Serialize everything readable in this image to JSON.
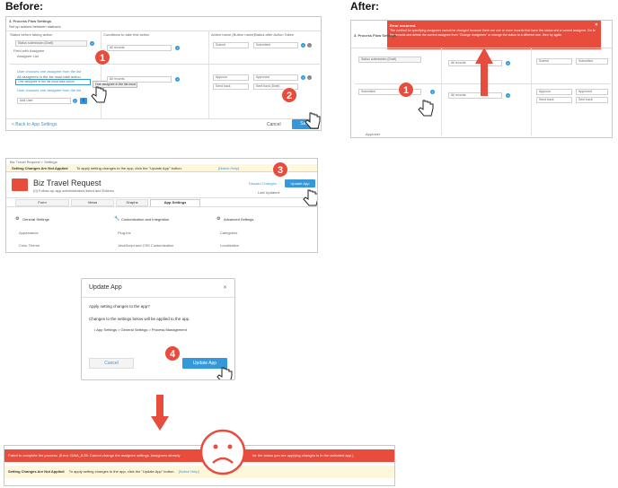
{
  "headings": {
    "before": "Before:",
    "after": "After:"
  },
  "before_panel": {
    "title": "3. Process Flow Settings",
    "subtitle": "Set up actions between statuses",
    "col_status_before": "Status before taking action",
    "col_conditions": "Conditions to take this action",
    "col_action_name": "Action name (Button name)",
    "col_status_after": "Status after Action Taken",
    "status1": "Status submission (Draft)",
    "assignee_label": "Field with Assignee",
    "assignee_list": "Assignee List",
    "condition": "All records",
    "action1": "Submit",
    "after1": "Submitted",
    "user_choose": "User chooses one assignee from the list",
    "opt1": "All assignees in the list must take action",
    "opt2": "One assignee in the list must take action",
    "dropdown_hint": "One assignee in the list must take action",
    "action2": "Approve",
    "after2": "Approved",
    "action3": "Send back",
    "after3": "Sent back (Draft)",
    "add_user": "Add User",
    "back_link": "< Back to App Settings",
    "cancel": "Cancel",
    "save": "Save"
  },
  "after_panel": {
    "error_title": "Error occurred.",
    "error_body": "The method for specifying assignees cannot be changed because there are one or more records that have this status and a current assignee. Go to the records and delete the current assignee from \"Change Assignees\" or change the status to a different one, then try again.",
    "title": "3. Process Flow Settings",
    "status1": "Status submission (Draft)",
    "status2": "Submitted",
    "condition": "All records",
    "action1": "Submit",
    "after1": "Submitted",
    "action2": "Approve",
    "action3": "Send back",
    "after2": "Approved",
    "after3": "Sent back",
    "assignee": "Approver"
  },
  "app_panel": {
    "notice": "Setting Changes Are Not Applied",
    "notice_detail": "To apply setting changes to the app, click the \"Update App\" button.",
    "notice_link": "[Notice Help]",
    "app_name": "Biz Travel Request",
    "app_desc": "(0) Follow-up app administrators listed and Eckbes",
    "discard": "Discard Changes",
    "update": "Update App",
    "last_updated": "Last Updated:",
    "tabs": [
      "Form",
      "Views",
      "Graphs",
      "App Settings"
    ],
    "sections": [
      "General Settings",
      "Customization and Integration",
      "Advanced Settings"
    ],
    "items": [
      "Appearance",
      "Plug-ins",
      "Categories",
      "Color Theme",
      "JavaScript and CSS Customization",
      "Localization"
    ],
    "breadcrumb": "Biz Travel Request > Settings"
  },
  "dialog": {
    "title": "Update App",
    "question": "Apply setting changes to the app?",
    "detail": "Changes to the settings below will be applied to the app.",
    "bullet": "App Settings > General Settings > Process Management",
    "cancel": "Cancel",
    "update": "Update App"
  },
  "bottom": {
    "error": "Failed to complete the process. (Error: GAIA_IL35: Cannot change the assignee settings. Assignees already",
    "error_tail": "for the status you are applying changes to in the activated app.)",
    "notice": "Setting Changes Are Not Applied",
    "notice_detail": "To apply setting changes to the app, click the \"Update App\" button.",
    "notice_link": "[Notice Help]"
  },
  "steps": [
    "1",
    "2",
    "1",
    "3",
    "4"
  ],
  "colors": {
    "accent": "#3498db",
    "error": "#e74c3c",
    "notice": "#fff7dc"
  },
  "icons": [
    "hand-cursor-icon",
    "down-arrow-icon",
    "up-arrow-icon",
    "sad-face-icon",
    "app-logo-icon",
    "gear-icon",
    "wrench-icon",
    "close-icon",
    "search-icon",
    "user-icon"
  ]
}
